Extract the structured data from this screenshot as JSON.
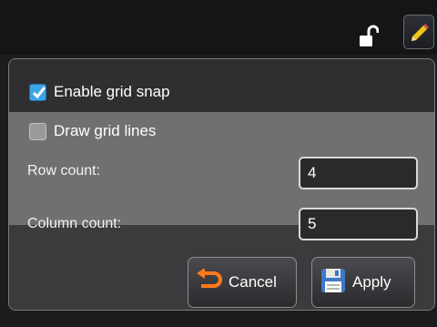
{
  "toolbar": {
    "lock_icon": "unlock-icon",
    "edit_icon": "pencil-icon",
    "accent": "#f0c419"
  },
  "grid_settings": {
    "enable_grid_snap": {
      "label": "Enable grid snap",
      "checked": true
    },
    "draw_grid_lines": {
      "label": "Draw grid lines",
      "checked": false
    },
    "row_count": {
      "label": "Row count:",
      "value": "4"
    },
    "column_count": {
      "label": "Column count:",
      "value": "5"
    }
  },
  "buttons": {
    "cancel": {
      "label": "Cancel",
      "icon": "undo-arrow-icon"
    },
    "apply": {
      "label": "Apply",
      "icon": "floppy-disk-icon"
    }
  },
  "colors": {
    "checkbox_accent": "#3fa4e6",
    "cancel_icon": "#ff7a1a"
  }
}
